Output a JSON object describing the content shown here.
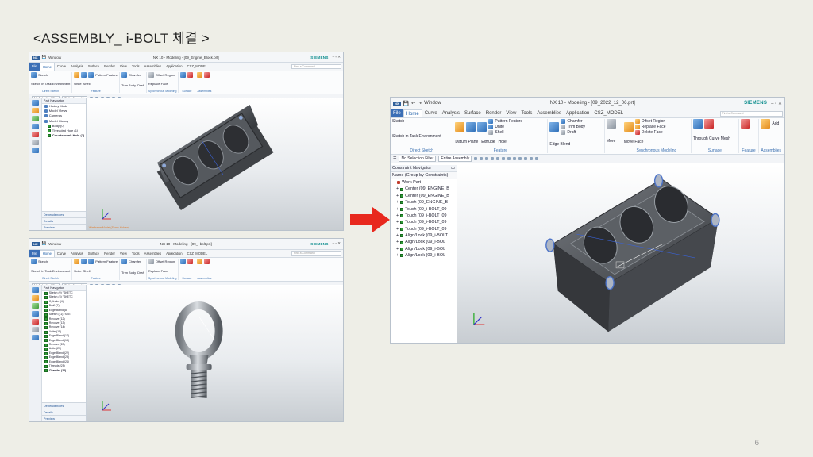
{
  "slide": {
    "title": "<ASSEMBLY_ i-BOLT 체결 >",
    "page_number": "6"
  },
  "window_common": {
    "nx_badge": "NX",
    "siemens": "SIEMENS",
    "menus": [
      "File",
      "Home",
      "Curve",
      "Analysis",
      "Surface",
      "Render",
      "View",
      "Tools",
      "Assemblies",
      "Application",
      "CSZ_MODEL"
    ],
    "command_finder": "Find a Command",
    "selection_filter": "No Selection Filter",
    "assembly_scope": "Entire Assembly",
    "ribbon": {
      "sketch": "Sketch",
      "sketch_task": "Sketch in Task Environment",
      "direct_sketch": "Direct Sketch",
      "datum_plane": "Datum Plane",
      "extrude": "Extrude",
      "hole": "Hole",
      "pattern_feature": "Pattern Feature",
      "unite": "Unite",
      "shell": "Shell",
      "feature_group": "Feature",
      "edge_blend": "Edge Blend",
      "chamfer": "Chamfer",
      "trim_body": "Trim Body",
      "draft": "Draft",
      "more": "More",
      "move_face": "Move Face",
      "offset_region": "Offset Region",
      "replace_face": "Replace Face",
      "delete_face": "Delete Face",
      "sync_group": "Synchronous Modeling",
      "through_curve_mesh": "Through Curve Mesh",
      "surface_group": "Surface",
      "add": "Add",
      "assemblies_group": "Assemblies"
    },
    "window_menu": "Window"
  },
  "top_left_window": {
    "title": "NX 10 - Modeling - [09_Engine_Block.prt]",
    "navigator_title": "Part Navigator",
    "items": [
      "History Mode",
      "Model Views",
      "Cameras",
      "Model History",
      "Body (0)",
      "Threaded Hole (1)",
      "Countersunk Hole (2)"
    ],
    "panels": [
      "Dependencies",
      "Details",
      "Preview"
    ],
    "status": "Wireframe Model (Some Hidden)"
  },
  "bottom_left_window": {
    "title": "NX 10 - Modeling - [09_i-bolt.prt]",
    "navigator_title": "Part Navigator",
    "items": [
      "Sketch (0) \"SKETC",
      "Sketch (3) \"SKETC",
      "Cylinder (4)",
      "Draft (7)",
      "Edge Blend (8)",
      "Sketch (11) \"SKET",
      "Revolve (12)",
      "Revolve (13)",
      "Revolve (14)",
      "Unite (15)",
      "Edge Blend (17)",
      "Edge Blend (18)",
      "Revolve (20)",
      "Unite (21)",
      "Edge Blend (22)",
      "Edge Blend (23)",
      "Edge Blend (24)",
      "Threads (25)",
      "Chamfer (26)"
    ],
    "panels": [
      "Dependencies",
      "Details",
      "Preview"
    ]
  },
  "main_window": {
    "title": "NX 10 - Modeling - [09_2022_12_06.prt]",
    "navigator_title": "Constraint Navigator",
    "column_header": "Name (Group by Constraints)",
    "root": "Work Part",
    "constraints": [
      "Center (09_ENGINE_B",
      "Center (09_ENGINE_B",
      "Touch (09_ENGINE_B",
      "Touch (09_i-BOLT_09",
      "Touch (09_i-BOLT_09",
      "Touch (09_i-BOLT_09",
      "Touch (09_i-BOLT_09",
      "Align/Lock (09_i-BOLT",
      "Align/Lock (09_i-BOL",
      "Align/Lock (09_i-BOL",
      "Align/Lock (09_i-BOL"
    ]
  },
  "colors": {
    "arrow": "#e8281e",
    "accent": "#3b6fb6",
    "model": "#4b4e53"
  }
}
